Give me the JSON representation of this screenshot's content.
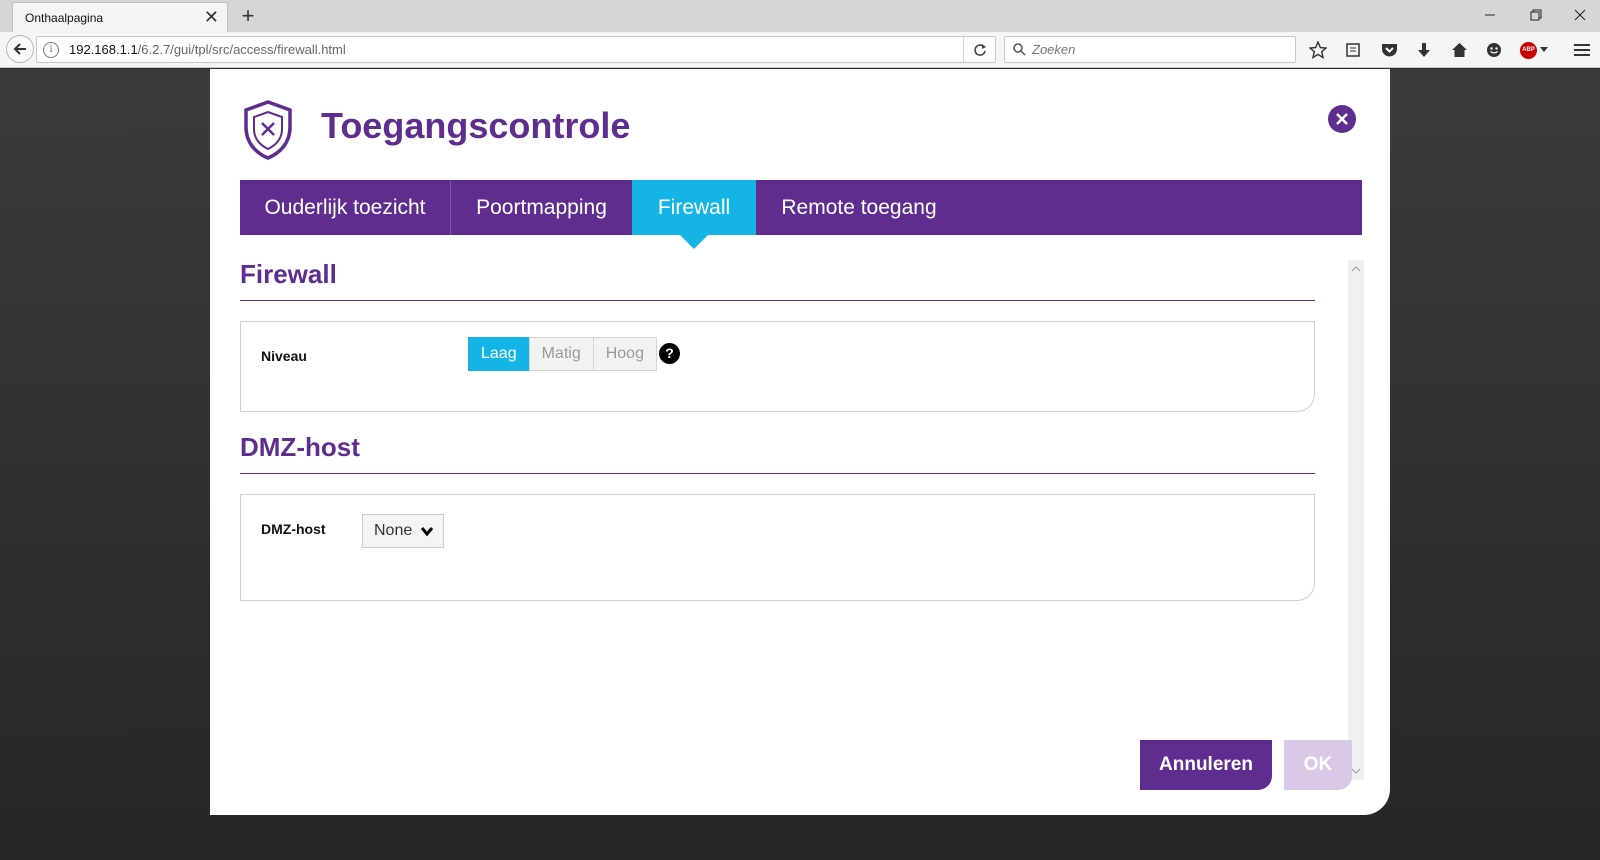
{
  "browser": {
    "tab_title": "Onthaalpagina",
    "tab_close": "✕",
    "new_tab": "+",
    "url_host": "192.168.1.1",
    "url_path": "/6.2.7/gui/tpl/src/access/firewall.html",
    "search_placeholder": "Zoeken",
    "abp_label": "ABP"
  },
  "dialog": {
    "title": "Toegangscontrole",
    "tabs": [
      {
        "label": "Ouderlijk toezicht",
        "active": false
      },
      {
        "label": "Poortmapping",
        "active": false
      },
      {
        "label": "Firewall",
        "active": true
      },
      {
        "label": "Remote toegang",
        "active": false
      }
    ],
    "firewall": {
      "section_title": "Firewall",
      "level_label": "Niveau",
      "levels": [
        "Laag",
        "Matig",
        "Hoog"
      ],
      "selected_level": "Laag",
      "help": "?"
    },
    "dmz": {
      "section_title": "DMZ-host",
      "label": "DMZ-host",
      "selected": "None"
    },
    "buttons": {
      "cancel": "Annuleren",
      "ok": "OK"
    }
  },
  "colors": {
    "brand": "#5f2d8f",
    "active": "#14b5e6",
    "ok_disabled": "#d9c9e6"
  }
}
